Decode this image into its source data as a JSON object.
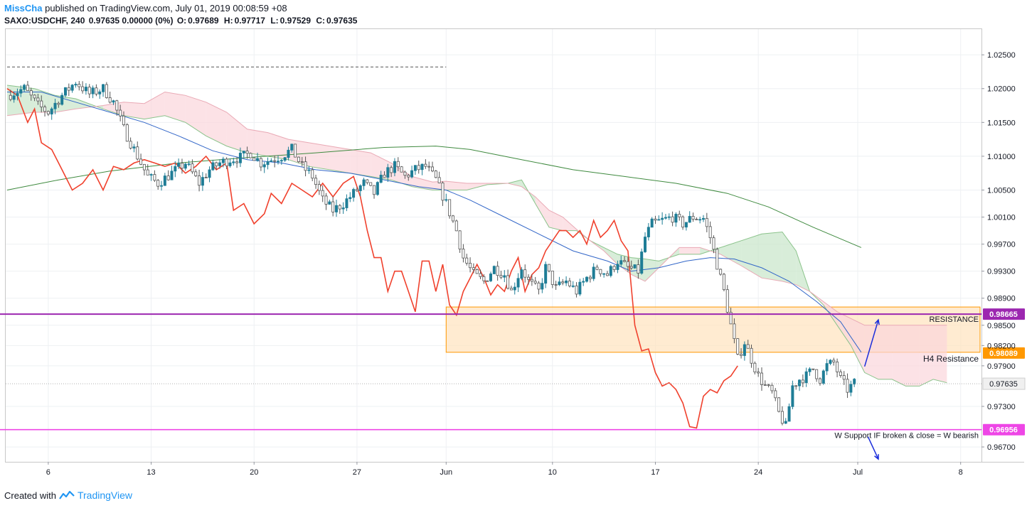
{
  "header": {
    "author": "MissCha",
    "published": "published on TradingView.com, July 01, 2019 00:08:59 +08",
    "symbol": "SAXO:USDCHF, 240",
    "quote": "0.97635 0.00000 (0%)",
    "open_label": "O:",
    "open": "0.97689",
    "high_label": "H:",
    "high": "0.97717",
    "low_label": "L:",
    "low": "0.97529",
    "close_label": "C:",
    "close": "0.97635"
  },
  "footer": {
    "created_with": "Created with",
    "brand": "TradingView"
  },
  "colors": {
    "bull": "#1e7d96",
    "bear": "#555555",
    "red_line": "#f0412d",
    "ma_blue": "#3266c8",
    "ma_green": "#3f8a3f",
    "resistance": "#9c27b0",
    "support": "#ee46e6",
    "h4_zone": "#ffe2bd",
    "h4_border": "#ff9800",
    "arrow": "#1a2ddb"
  },
  "chart_data": {
    "type": "candlestick",
    "symbol": "SAXO:USDCHF",
    "timeframe": "240",
    "ylim": [
      0.9648,
      1.0288
    ],
    "y_ticks": [
      1.025,
      1.02,
      1.015,
      1.01,
      1.005,
      1.001,
      0.997,
      0.993,
      0.989,
      0.985,
      0.982,
      0.979,
      0.973,
      0.967
    ],
    "y_tick_labels": [
      "1.02500",
      "1.02000",
      "1.01500",
      "1.01000",
      "1.00500",
      "1.00100",
      "0.99700",
      "0.99300",
      "0.98900",
      "0.98500",
      "0.98200",
      "0.97900",
      "0.97300",
      "0.96700"
    ],
    "x_tick_labels": [
      "6",
      "13",
      "20",
      "27",
      "Jun",
      "10",
      "17",
      "24",
      "Jul",
      "8"
    ],
    "x_tick_bars": [
      12,
      42,
      72,
      102,
      128,
      159,
      189,
      219,
      248,
      278
    ],
    "total_bars": 282,
    "last_price": {
      "label": "0.97635",
      "value": 0.97635
    },
    "levels": [
      {
        "name": "RESISTANCE",
        "value": 0.98665,
        "label": "0.98665"
      },
      {
        "name": "H4 Resistance",
        "value": 0.98089,
        "label": "0.98089"
      },
      {
        "name": "W Support IF broken & close = W bearish",
        "value": 0.96956,
        "label": "0.96956"
      }
    ],
    "h4_zone": {
      "top": 0.9877,
      "bottom": 0.981,
      "from_bar": 128,
      "to_bar": 282
    },
    "top_dashed_level": {
      "value": 1.0232,
      "from_bar": 0,
      "to_bar": 128
    },
    "close_path": [
      [
        0,
        1.019
      ],
      [
        5,
        1.02
      ],
      [
        9,
        1.0175
      ],
      [
        12,
        1.0165
      ],
      [
        16,
        1.019
      ],
      [
        20,
        1.021
      ],
      [
        24,
        1.0192
      ],
      [
        28,
        1.02
      ],
      [
        31,
        1.018
      ],
      [
        34,
        1.014
      ],
      [
        38,
        1.01
      ],
      [
        41,
        1.007
      ],
      [
        44,
        1.006
      ],
      [
        48,
        1.0075
      ],
      [
        52,
        1.009
      ],
      [
        56,
        1.006
      ],
      [
        59,
        1.008
      ],
      [
        62,
        1.009
      ],
      [
        65,
        1.0095
      ],
      [
        68,
        1.0098
      ],
      [
        71,
        1.0105
      ],
      [
        74,
        1.009
      ],
      [
        77,
        1.0095
      ],
      [
        80,
        1.01
      ],
      [
        83,
        1.011
      ],
      [
        86,
        1.0085
      ],
      [
        89,
        1.007
      ],
      [
        92,
        1.0035
      ],
      [
        95,
        1.002
      ],
      [
        98,
        1.003
      ],
      [
        101,
        1.0045
      ],
      [
        104,
        1.006
      ],
      [
        107,
        1.0045
      ],
      [
        110,
        1.0075
      ],
      [
        113,
        1.0085
      ],
      [
        116,
        1.007
      ],
      [
        119,
        1.008
      ],
      [
        122,
        1.0085
      ],
      [
        125,
        1.0065
      ],
      [
        128,
        1.003
      ],
      [
        131,
        0.999
      ],
      [
        133,
        0.995
      ],
      [
        136,
        0.9925
      ],
      [
        139,
        0.9915
      ],
      [
        142,
        0.9935
      ],
      [
        145,
        0.9925
      ],
      [
        147,
        0.99
      ],
      [
        150,
        0.9935
      ],
      [
        152,
        0.9915
      ],
      [
        155,
        0.99
      ],
      [
        157,
        0.9935
      ],
      [
        160,
        0.9905
      ],
      [
        163,
        0.9915
      ],
      [
        166,
        0.99
      ],
      [
        169,
        0.992
      ],
      [
        172,
        0.9935
      ],
      [
        175,
        0.9925
      ],
      [
        178,
        0.9945
      ],
      [
        181,
        0.9935
      ],
      [
        184,
        0.993
      ],
      [
        186,
        0.998
      ],
      [
        188,
        1.0
      ],
      [
        191,
        1.0005
      ],
      [
        194,
        1.001
      ],
      [
        197,
        1.0
      ],
      [
        200,
        1.001
      ],
      [
        203,
        1.0008
      ],
      [
        205,
        0.998
      ],
      [
        207,
        0.994
      ],
      [
        209,
        0.99
      ],
      [
        211,
        0.985
      ],
      [
        213,
        0.98
      ],
      [
        215,
        0.9825
      ],
      [
        217,
        0.98
      ],
      [
        219,
        0.9775
      ],
      [
        221,
        0.976
      ],
      [
        223,
        0.975
      ],
      [
        225,
        0.972
      ],
      [
        227,
        0.97
      ],
      [
        229,
        0.976
      ],
      [
        231,
        0.977
      ],
      [
        233,
        0.9775
      ],
      [
        235,
        0.9785
      ],
      [
        237,
        0.977
      ],
      [
        239,
        0.979
      ],
      [
        241,
        0.9795
      ],
      [
        243,
        0.977
      ],
      [
        245,
        0.9755
      ],
      [
        247,
        0.9764
      ]
    ],
    "lagging_line": [
      [
        0,
        1.02
      ],
      [
        3,
        1.019
      ],
      [
        6,
        1.015
      ],
      [
        8,
        1.017
      ],
      [
        10,
        1.012
      ],
      [
        13,
        1.011
      ],
      [
        16,
        1.008
      ],
      [
        19,
        1.005
      ],
      [
        22,
        1.006
      ],
      [
        25,
        1.008
      ],
      [
        28,
        1.005
      ],
      [
        31,
        1.0085
      ],
      [
        34,
        1.008
      ],
      [
        37,
        1.009
      ],
      [
        40,
        1.0095
      ],
      [
        43,
        1.009
      ],
      [
        46,
        1.0085
      ],
      [
        49,
        1.009
      ],
      [
        52,
        1.0075
      ],
      [
        55,
        1.0085
      ],
      [
        58,
        1.01
      ],
      [
        61,
        1.008
      ],
      [
        64,
        1.009
      ],
      [
        66,
        1.002
      ],
      [
        69,
        1.003
      ],
      [
        72,
        1.0
      ],
      [
        75,
        1.0015
      ],
      [
        77,
        1.0045
      ],
      [
        80,
        1.003
      ],
      [
        83,
        1.006
      ],
      [
        86,
        1.005
      ],
      [
        89,
        1.004
      ],
      [
        92,
        1.006
      ],
      [
        95,
        1.004
      ],
      [
        98,
        1.006
      ],
      [
        101,
        1.007
      ],
      [
        103,
        1.004
      ],
      [
        105,
        0.999
      ],
      [
        107,
        0.995
      ],
      [
        109,
        0.995
      ],
      [
        111,
        0.99
      ],
      [
        113,
        0.993
      ],
      [
        115,
        0.993
      ],
      [
        117,
        0.99
      ],
      [
        119,
        0.987
      ],
      [
        121,
        0.9945
      ],
      [
        123,
        0.9945
      ],
      [
        125,
        0.99
      ],
      [
        127,
        0.994
      ],
      [
        129,
        0.988
      ],
      [
        131,
        0.9865
      ],
      [
        133,
        0.99
      ],
      [
        135,
        0.992
      ],
      [
        137,
        0.994
      ],
      [
        139,
        0.992
      ],
      [
        141,
        0.9895
      ],
      [
        143,
        0.991
      ],
      [
        145,
        0.99
      ],
      [
        147,
        0.993
      ],
      [
        149,
        0.995
      ],
      [
        151,
        0.99
      ],
      [
        153,
        0.9925
      ],
      [
        155,
        0.9935
      ],
      [
        157,
        0.996
      ],
      [
        159,
        0.9975
      ],
      [
        161,
        0.999
      ],
      [
        163,
        0.999
      ],
      [
        165,
        0.998
      ],
      [
        167,
        0.999
      ],
      [
        169,
        0.997
      ],
      [
        171,
        1.0005
      ],
      [
        173,
        0.998
      ],
      [
        175,
        0.999
      ],
      [
        177,
        1.0005
      ],
      [
        179,
        0.9975
      ],
      [
        181,
        0.996
      ],
      [
        183,
        0.985
      ],
      [
        185,
        0.9812
      ],
      [
        187,
        0.9815
      ],
      [
        189,
        0.978
      ],
      [
        191,
        0.976
      ],
      [
        193,
        0.9765
      ],
      [
        195,
        0.9755
      ],
      [
        197,
        0.9735
      ],
      [
        199,
        0.97
      ],
      [
        201,
        0.9698
      ],
      [
        203,
        0.9745
      ],
      [
        205,
        0.9755
      ],
      [
        207,
        0.975
      ],
      [
        209,
        0.9768
      ],
      [
        211,
        0.9775
      ],
      [
        213,
        0.979
      ]
    ],
    "ma_fast": [
      [
        0,
        1.0195
      ],
      [
        10,
        1.0195
      ],
      [
        20,
        1.018
      ],
      [
        30,
        1.0165
      ],
      [
        40,
        1.015
      ],
      [
        50,
        1.013
      ],
      [
        60,
        1.0108
      ],
      [
        70,
        1.0095
      ],
      [
        80,
        1.009
      ],
      [
        90,
        1.008
      ],
      [
        100,
        1.0075
      ],
      [
        110,
        1.0065
      ],
      [
        120,
        1.0055
      ],
      [
        128,
        1.005
      ],
      [
        135,
        1.0035
      ],
      [
        145,
        1.001
      ],
      [
        155,
        0.9985
      ],
      [
        165,
        0.996
      ],
      [
        175,
        0.9945
      ],
      [
        182,
        0.993
      ],
      [
        190,
        0.9935
      ],
      [
        198,
        0.9945
      ],
      [
        205,
        0.995
      ],
      [
        212,
        0.9948
      ],
      [
        220,
        0.9935
      ],
      [
        228,
        0.9915
      ],
      [
        236,
        0.9885
      ],
      [
        243,
        0.9855
      ],
      [
        249,
        0.981
      ]
    ],
    "ma_slow": [
      [
        0,
        1.005
      ],
      [
        15,
        1.0065
      ],
      [
        30,
        1.0078
      ],
      [
        50,
        1.009
      ],
      [
        70,
        1.0098
      ],
      [
        90,
        1.0105
      ],
      [
        110,
        1.0113
      ],
      [
        125,
        1.0115
      ],
      [
        135,
        1.011
      ],
      [
        150,
        1.0095
      ],
      [
        165,
        1.008
      ],
      [
        180,
        1.007
      ],
      [
        195,
        1.006
      ],
      [
        210,
        1.0045
      ],
      [
        222,
        1.0025
      ],
      [
        235,
        0.9995
      ],
      [
        249,
        0.9965
      ]
    ],
    "cloud": {
      "from_bar": 0,
      "span_a": [
        [
          0,
          1.0205
        ],
        [
          8,
          1.02
        ],
        [
          14,
          1.019
        ],
        [
          20,
          1.0185
        ],
        [
          28,
          1.017
        ],
        [
          34,
          1.016
        ],
        [
          40,
          1.0155
        ],
        [
          46,
          1.016
        ],
        [
          52,
          1.015
        ],
        [
          58,
          1.013
        ],
        [
          64,
          1.0115
        ],
        [
          70,
          1.0105
        ],
        [
          76,
          1.01
        ],
        [
          82,
          1.0095
        ],
        [
          88,
          1.0085
        ],
        [
          94,
          1.008
        ],
        [
          100,
          1.0075
        ],
        [
          106,
          1.007
        ],
        [
          112,
          1.0065
        ],
        [
          118,
          1.0055
        ],
        [
          124,
          1.005
        ],
        [
          128,
          1.005
        ],
        [
          134,
          1.005
        ],
        [
          140,
          1.0058
        ],
        [
          146,
          1.006
        ],
        [
          150,
          1.0065
        ],
        [
          154,
          1.003
        ],
        [
          158,
          0.9995
        ],
        [
          162,
          0.999
        ],
        [
          166,
          0.999
        ],
        [
          170,
          0.9975
        ],
        [
          174,
          0.9965
        ],
        [
          178,
          0.9955
        ],
        [
          182,
          0.995
        ],
        [
          186,
          0.9948
        ],
        [
          190,
          0.9945
        ],
        [
          196,
          0.9955
        ],
        [
          202,
          0.9955
        ],
        [
          208,
          0.9965
        ],
        [
          214,
          0.9975
        ],
        [
          220,
          0.9985
        ],
        [
          226,
          0.9988
        ],
        [
          230,
          0.996
        ],
        [
          234,
          0.99
        ],
        [
          238,
          0.988
        ],
        [
          242,
          0.985
        ],
        [
          246,
          0.982
        ],
        [
          250,
          0.978
        ],
        [
          254,
          0.977
        ],
        [
          258,
          0.977
        ],
        [
          262,
          0.976
        ],
        [
          266,
          0.976
        ],
        [
          270,
          0.977
        ],
        [
          274,
          0.9765
        ]
      ],
      "span_b": [
        [
          0,
          1.016
        ],
        [
          8,
          1.0165
        ],
        [
          14,
          1.0165
        ],
        [
          20,
          1.017
        ],
        [
          28,
          1.0175
        ],
        [
          34,
          1.018
        ],
        [
          40,
          1.0178
        ],
        [
          46,
          1.0195
        ],
        [
          52,
          1.019
        ],
        [
          58,
          1.018
        ],
        [
          64,
          1.0165
        ],
        [
          70,
          1.014
        ],
        [
          76,
          1.0135
        ],
        [
          82,
          1.0125
        ],
        [
          88,
          1.012
        ],
        [
          94,
          1.0115
        ],
        [
          100,
          1.011
        ],
        [
          106,
          1.0105
        ],
        [
          112,
          1.009
        ],
        [
          118,
          1.007
        ],
        [
          124,
          1.0062
        ],
        [
          128,
          1.0063
        ],
        [
          134,
          1.006
        ],
        [
          140,
          1.006
        ],
        [
          146,
          1.006
        ],
        [
          150,
          1.0055
        ],
        [
          154,
          1.004
        ],
        [
          158,
          1.002
        ],
        [
          162,
          1.001
        ],
        [
          166,
          0.9992
        ],
        [
          170,
          0.9975
        ],
        [
          174,
          0.996
        ],
        [
          178,
          0.994
        ],
        [
          182,
          0.9925
        ],
        [
          186,
          0.9915
        ],
        [
          190,
          0.9935
        ],
        [
          196,
          0.9965
        ],
        [
          202,
          0.9965
        ],
        [
          208,
          0.9955
        ],
        [
          214,
          0.9938
        ],
        [
          220,
          0.992
        ],
        [
          226,
          0.9915
        ],
        [
          230,
          0.991
        ],
        [
          234,
          0.99
        ],
        [
          238,
          0.9885
        ],
        [
          242,
          0.987
        ],
        [
          246,
          0.986
        ],
        [
          250,
          0.985
        ],
        [
          254,
          0.985
        ],
        [
          258,
          0.985
        ],
        [
          262,
          0.985
        ],
        [
          266,
          0.985
        ],
        [
          270,
          0.985
        ],
        [
          274,
          0.985
        ]
      ]
    },
    "annotations": [
      {
        "text": "RESISTANCE",
        "at_value": 0.98665
      },
      {
        "text": "H4 Resistance",
        "at_value": 0.98089
      },
      {
        "text": "W Support IF broken & close = W bearish",
        "at_value": 0.96956
      }
    ],
    "projection_arrows": [
      {
        "direction": "up",
        "from_bar": 250,
        "from_value": 0.9789,
        "to_bar": 254,
        "to_value": 0.9858
      },
      {
        "direction": "down",
        "from_bar": 251,
        "from_value": 0.9685,
        "to_bar": 254,
        "to_value": 0.9652
      }
    ]
  }
}
